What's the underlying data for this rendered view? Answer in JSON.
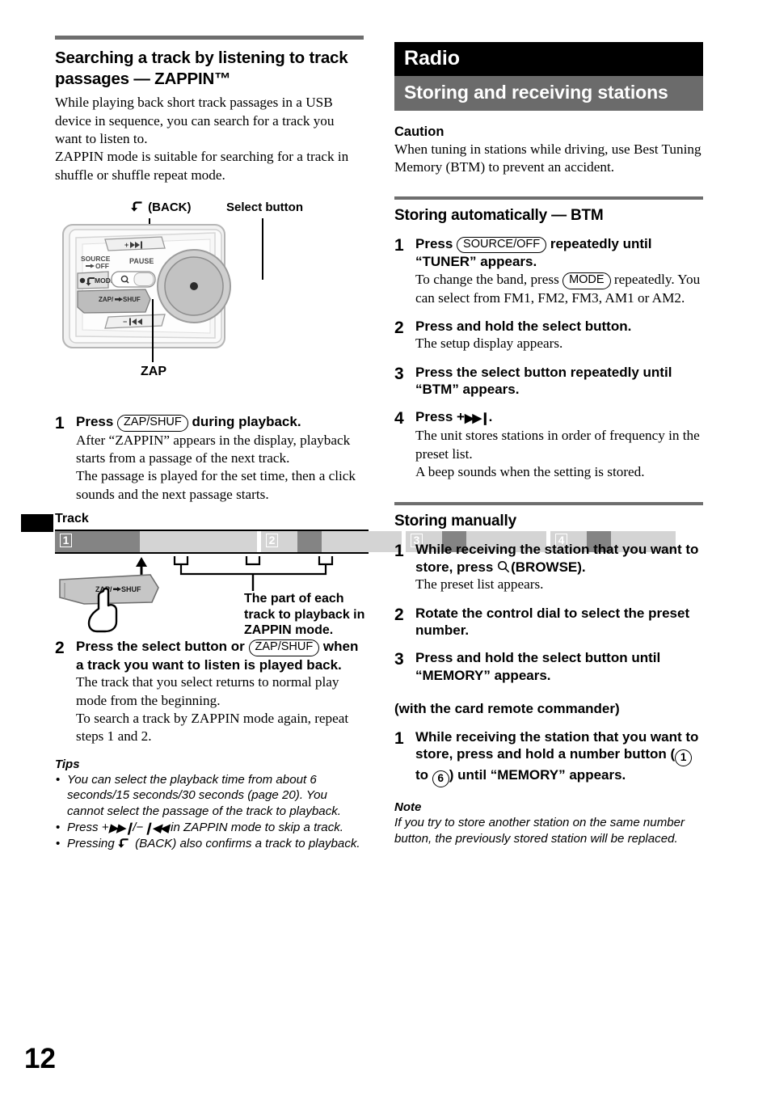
{
  "page": {
    "number": "12"
  },
  "left_column": {
    "heading": "Searching a track by listening to track passages — ZAPPIN™",
    "intro_1": "While playing back short track passages in a USB device in sequence, you can search for a track you want to listen to.",
    "intro_2": "ZAPPIN mode is suitable for searching for a track in shuffle or shuffle repeat mode.",
    "unit_figure": {
      "label_back": "(BACK)",
      "label_select": "Select button",
      "label_zap": "ZAP",
      "buttons": {
        "source": "SOURCE",
        "source_off": "OFF",
        "pause": "PAUSE",
        "mode": "MODE",
        "skip_fwd": "+",
        "skip_back": "−",
        "zapshuf": "ZAP/   SHUF"
      }
    },
    "steps": [
      {
        "num": "1",
        "head_pre": "Press ",
        "head_pill": "ZAP/SHUF",
        "head_post": " during playback.",
        "sub_1": "After “ZAPPIN” appears in the display, playback starts from a passage of the next track.",
        "sub_2": "The passage is played for the set time, then a click sounds and the next passage starts."
      },
      {
        "num": "2",
        "head_pre": "Press the select button or ",
        "head_pill": "ZAP/SHUF",
        "head_post": " when a track you want to listen is played back.",
        "sub_1": "The track that you select returns to normal play mode from the beginning.",
        "sub_2": "To search a track by ZAPPIN mode again, repeat steps 1 and 2."
      }
    ],
    "track_figure": {
      "title": "Track",
      "track_numbers": [
        "1",
        "2",
        "3",
        "4"
      ],
      "button_label": "ZAP/   SHUF",
      "caption": "The part of each track to playback in ZAPPIN mode."
    },
    "tips_heading": "Tips",
    "tips": [
      "You can select the playback time from about 6 seconds/15 seconds/30 seconds (page 20). You cannot select the passage of the track to playback.",
      "Press + / −  in ZAPPIN mode to skip a track.",
      "Pressing  (BACK) also confirms a track to playback."
    ],
    "tip2_pre": "Press +",
    "tip2_mid": "/−",
    "tip2_post": " in ZAPPIN mode to skip a track.",
    "tip3_pre": "Pressing ",
    "tip3_post": " (BACK) also confirms a track to playback."
  },
  "right_column": {
    "chapter_banner": "Radio",
    "section_banner": "Storing and receiving stations",
    "caution_heading": "Caution",
    "caution_text": "When tuning in stations while driving, use Best Tuning Memory (BTM) to prevent an accident.",
    "btm": {
      "heading": "Storing automatically — BTM",
      "steps": [
        {
          "num": "1",
          "head_pre": "Press ",
          "head_pill": "SOURCE/OFF",
          "head_post": " repeatedly until “TUNER” appears.",
          "sub_pre": "To change the band, press ",
          "sub_pill": "MODE",
          "sub_post": " repeatedly. You can select from FM1, FM2, FM3, AM1 or AM2."
        },
        {
          "num": "2",
          "head": "Press and hold the select button.",
          "sub_1": "The setup display appears."
        },
        {
          "num": "3",
          "head": "Press the select button repeatedly until “BTM” appears."
        },
        {
          "num": "4",
          "head_pre": "Press +",
          "head_post": ".",
          "sub_1": "The unit stores stations in order of frequency in the preset list.",
          "sub_2": "A beep sounds when the setting is stored."
        }
      ]
    },
    "manual": {
      "heading": "Storing manually",
      "steps": [
        {
          "num": "1",
          "head_pre": "While receiving the station that you want to store, press ",
          "head_post": "(BROWSE).",
          "sub_1": "The preset list appears."
        },
        {
          "num": "2",
          "head": "Rotate the control dial to select the preset number."
        },
        {
          "num": "3",
          "head": "Press and hold the select button until “MEMORY” appears."
        }
      ],
      "remote_heading": "(with the card remote commander)",
      "remote_steps": [
        {
          "num": "1",
          "head_pre": "While receiving the station that you want to store, press and hold a number button (",
          "head_mid": " to ",
          "head_post": ") until “MEMORY” appears.",
          "btn_first": "1",
          "btn_last": "6"
        }
      ],
      "note_heading": "Note",
      "note_text": "If you try to store another station on the same number button, the previously stored station will be replaced."
    }
  }
}
